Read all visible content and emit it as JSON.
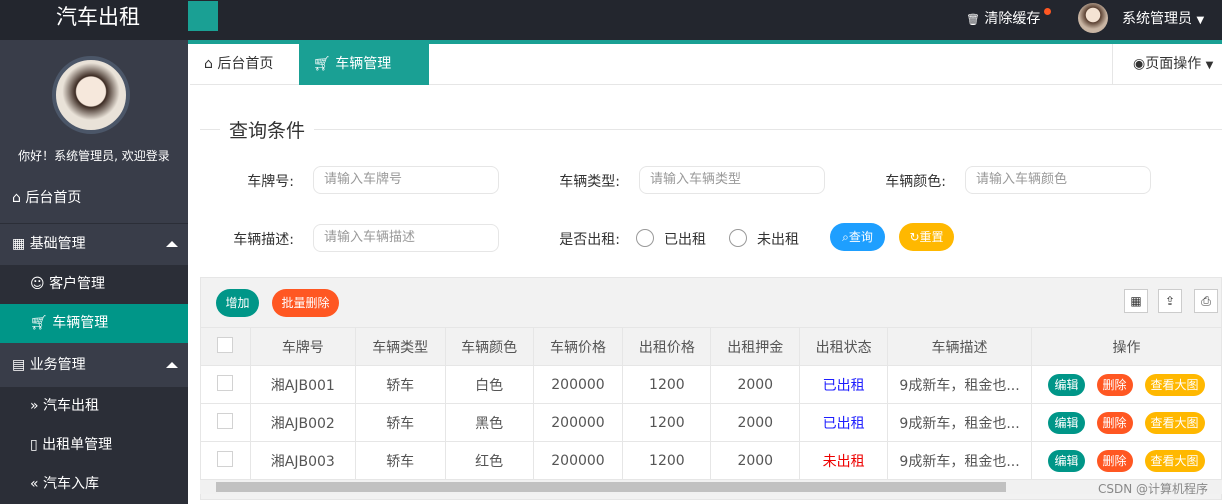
{
  "app": {
    "title": "汽车出租",
    "clear_cache": "清除缓存",
    "user": "系统管理员"
  },
  "sidebar": {
    "welcome": "你好！系统管理员, 欢迎登录",
    "items": [
      {
        "label": "后台首页",
        "icon": "home-icon"
      },
      {
        "label": "基础管理",
        "icon": "grid-icon"
      },
      {
        "label": "客户管理",
        "icon": "user-icon"
      },
      {
        "label": "车辆管理",
        "icon": "cart-icon"
      },
      {
        "label": "业务管理",
        "icon": "book-icon"
      },
      {
        "label": "汽车出租",
        "icon": "double-chevron-icon"
      },
      {
        "label": "出租单管理",
        "icon": "doc-icon"
      },
      {
        "label": "汽车入库",
        "icon": "double-chevron-left-icon"
      }
    ]
  },
  "tabs": [
    {
      "label": "后台首页"
    },
    {
      "label": "车辆管理"
    }
  ],
  "page_ops": "页面操作",
  "query": {
    "legend": "查询条件",
    "plate_label": "车牌号:",
    "plate_ph": "请输入车牌号",
    "type_label": "车辆类型:",
    "type_ph": "请输入车辆类型",
    "color_label": "车辆颜色:",
    "color_ph": "请输入车辆颜色",
    "desc_label": "车辆描述:",
    "desc_ph": "请输入车辆描述",
    "rented_label": "是否出租:",
    "opt_yes": "已出租",
    "opt_no": "未出租",
    "search": "查询",
    "reset": "重置"
  },
  "toolbar": {
    "add": "增加",
    "batch_delete": "批量删除"
  },
  "table": {
    "headers": [
      "车牌号",
      "车辆类型",
      "车辆颜色",
      "车辆价格",
      "出租价格",
      "出租押金",
      "出租状态",
      "车辆描述",
      "操作"
    ],
    "rows": [
      [
        "湘AJB001",
        "轿车",
        "白色",
        "200000",
        "1200",
        "2000",
        "已出租",
        "9成新车，租金也..."
      ],
      [
        "湘AJB002",
        "轿车",
        "黑色",
        "200000",
        "1200",
        "2000",
        "已出租",
        "9成新车，租金也..."
      ],
      [
        "湘AJB003",
        "轿车",
        "红色",
        "200000",
        "1200",
        "2000",
        "未出租",
        "9成新车，租金也..."
      ]
    ],
    "actions": {
      "edit": "编辑",
      "delete": "删除",
      "view": "查看大图"
    }
  },
  "watermark": "CSDN @计算机程序",
  "colors": {
    "teal": "#009688",
    "orange": "#ff5722",
    "yellow": "#ffb800",
    "blue": "#1e9fff"
  }
}
